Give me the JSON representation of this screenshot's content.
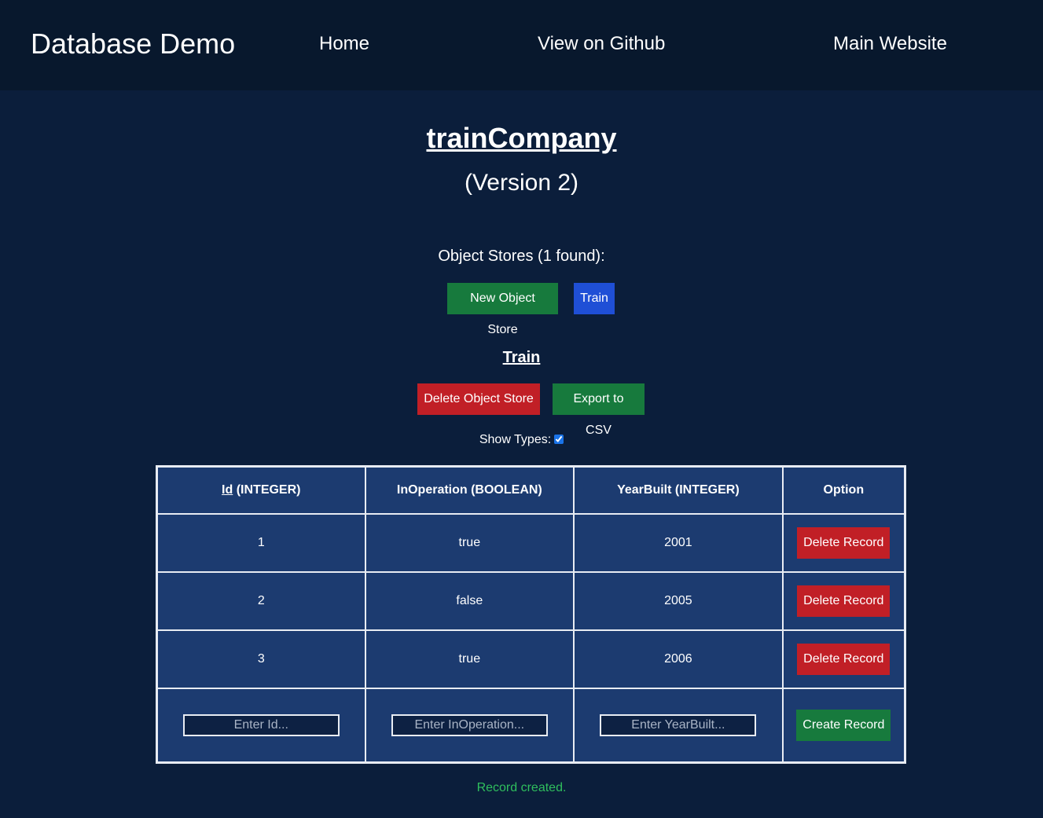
{
  "navbar": {
    "brand": "Database Demo",
    "links": [
      "Home",
      "View on Github",
      "Main Website"
    ]
  },
  "database": {
    "name": "trainCompany",
    "version": "(Version 2)"
  },
  "object_stores": {
    "label": "Object Stores (1 found):",
    "new_button": "New Object Store",
    "stores": [
      "Train"
    ]
  },
  "selected_store": {
    "name": "Train",
    "delete_button": "Delete Object Store",
    "export_button": "Export to CSV",
    "show_types_label": "Show Types:",
    "show_types_checked": true
  },
  "table": {
    "headers": [
      {
        "key": "Id",
        "type": " (INTEGER)"
      },
      {
        "key": "InOperation",
        "type": " (BOOLEAN)"
      },
      {
        "key": "YearBuilt",
        "type": " (INTEGER)"
      },
      {
        "key": "Option",
        "type": ""
      }
    ],
    "rows": [
      {
        "id": "1",
        "inoperation": "true",
        "yearbuilt": "2001",
        "action": "Delete Record"
      },
      {
        "id": "2",
        "inoperation": "false",
        "yearbuilt": "2005",
        "action": "Delete Record"
      },
      {
        "id": "3",
        "inoperation": "true",
        "yearbuilt": "2006",
        "action": "Delete Record"
      }
    ],
    "input_row": {
      "id_placeholder": "Enter Id...",
      "inoperation_placeholder": "Enter InOperation...",
      "yearbuilt_placeholder": "Enter YearBuilt...",
      "create_button": "Create Record"
    }
  },
  "status_message": "Record created.",
  "colors": {
    "background": "#0b1e3b",
    "navbar": "#08182d",
    "table_background": "#1c3b70",
    "green_button": "#177a3d",
    "red_button": "#c11f26",
    "blue_button": "#1f4fd6",
    "status_text": "#2fbf5d"
  }
}
